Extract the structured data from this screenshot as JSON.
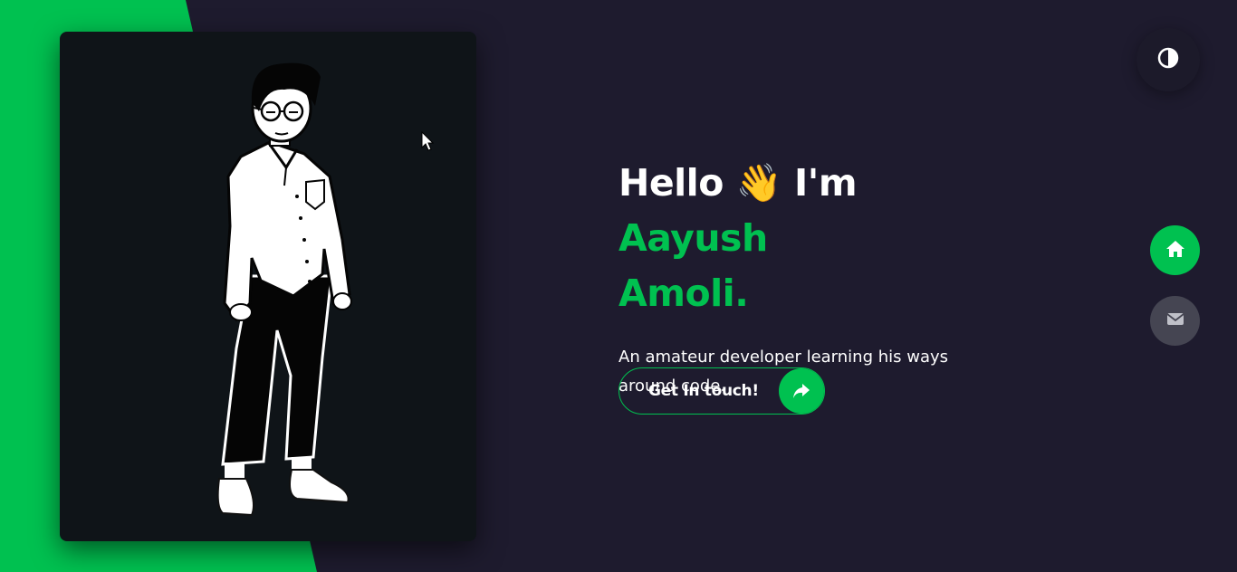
{
  "hero": {
    "greeting": "Hello",
    "wave_emoji": "👋",
    "intro": "I'm",
    "name_line1": "Aayush",
    "name_line2": "Amoli."
  },
  "description": "An amateur developer learning his ways around code.",
  "cta": {
    "label": "Get In touch!",
    "icon": "share-arrow-icon"
  },
  "theme_toggle": {
    "icon": "contrast-icon"
  },
  "side_nav": [
    {
      "icon": "home-icon",
      "active": true
    },
    {
      "icon": "mail-icon",
      "active": false
    }
  ],
  "colors": {
    "accent": "#00c150",
    "background": "#1e1b2e",
    "card": "#0f1418",
    "nav_inactive": "#454552",
    "text": "#ffffff"
  }
}
